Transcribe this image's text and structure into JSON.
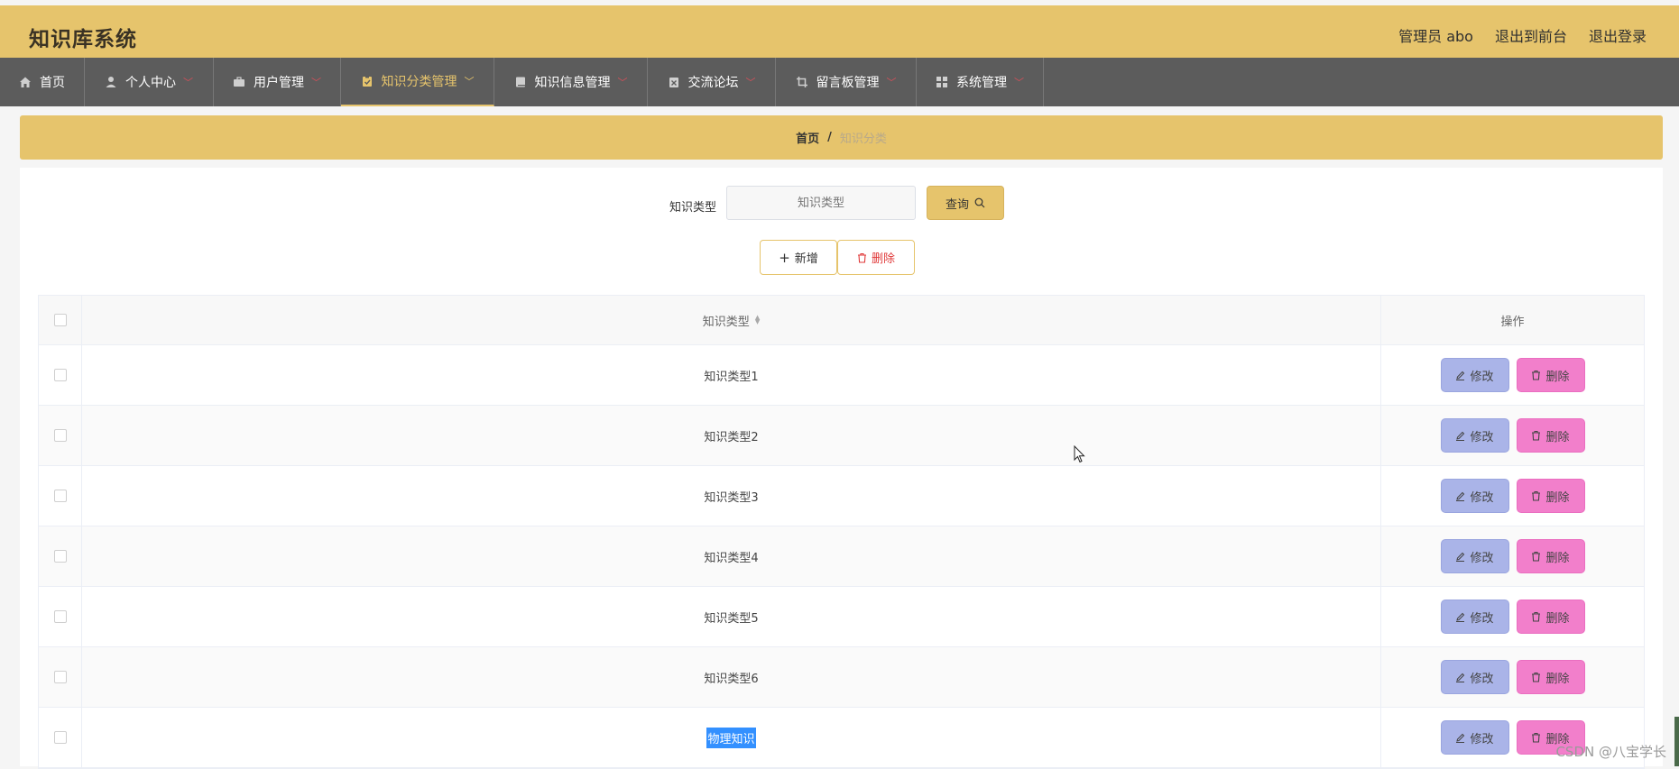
{
  "header": {
    "app_title": "知识库系统",
    "admin_label": "管理员 abo",
    "front_label": "退出到前台",
    "logout_label": "退出登录"
  },
  "nav": [
    {
      "label": "首页",
      "icon": "home-icon",
      "dropdown": false,
      "active": false
    },
    {
      "label": "个人中心",
      "icon": "user-icon",
      "dropdown": true,
      "active": false
    },
    {
      "label": "用户管理",
      "icon": "briefcase-icon",
      "dropdown": true,
      "active": false
    },
    {
      "label": "知识分类管理",
      "icon": "clipboard-icon",
      "dropdown": true,
      "active": true
    },
    {
      "label": "知识信息管理",
      "icon": "book-icon",
      "dropdown": true,
      "active": false
    },
    {
      "label": "交流论坛",
      "icon": "forum-icon",
      "dropdown": true,
      "active": false
    },
    {
      "label": "留言板管理",
      "icon": "crop-icon",
      "dropdown": true,
      "active": false
    },
    {
      "label": "系统管理",
      "icon": "grid-icon",
      "dropdown": true,
      "active": false
    }
  ],
  "breadcrumb": {
    "home": "首页",
    "separator": "/",
    "current": "知识分类"
  },
  "search": {
    "label": "知识类型",
    "placeholder": "知识类型",
    "button_label": "查询"
  },
  "actions": {
    "add_label": "新增",
    "delete_label": "删除"
  },
  "table": {
    "headers": {
      "type": "知识类型",
      "ops": "操作"
    },
    "rows": [
      {
        "type": "知识类型1",
        "selected_text": false
      },
      {
        "type": "知识类型2",
        "selected_text": false
      },
      {
        "type": "知识类型3",
        "selected_text": false
      },
      {
        "type": "知识类型4",
        "selected_text": false
      },
      {
        "type": "知识类型5",
        "selected_text": false
      },
      {
        "type": "知识类型6",
        "selected_text": false
      },
      {
        "type": "物理知识",
        "selected_text": true
      }
    ],
    "edit_label": "修改",
    "delete_label": "删除"
  },
  "watermark": "CSDN @八宝学长",
  "colors": {
    "accent": "#e6c46c",
    "nav_bg": "#5c5c5c",
    "edit_btn": "#aab4e8",
    "delete_btn": "#f27fcb",
    "delete_text": "#e03a3a"
  }
}
